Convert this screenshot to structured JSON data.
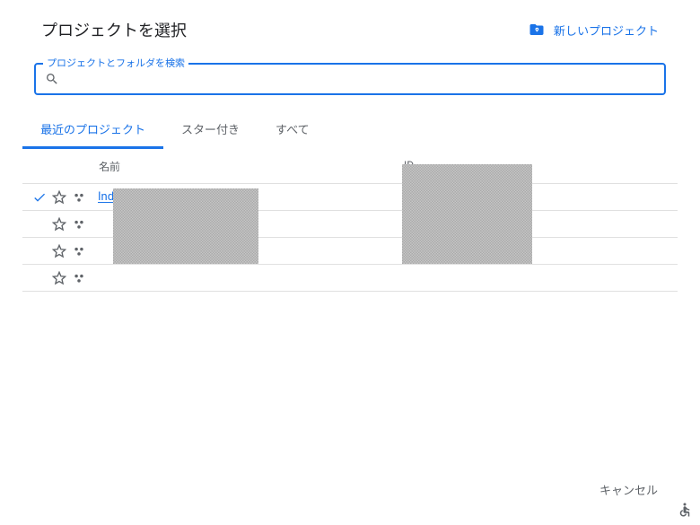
{
  "header": {
    "title": "プロジェクトを選択",
    "new_project_label": "新しいプロジェクト"
  },
  "search": {
    "legend": "プロジェクトとフォルダを検索",
    "value": "",
    "placeholder": ""
  },
  "tabs": {
    "recent": "最近のプロジェクト",
    "starred": "スター付き",
    "all": "すべて"
  },
  "table": {
    "columns": {
      "name": "名前",
      "id": "ID"
    },
    "rows": [
      {
        "selected": true,
        "name": "Indexing",
        "id": ""
      },
      {
        "selected": false,
        "name": "",
        "id": ""
      },
      {
        "selected": false,
        "name": "",
        "id": ""
      },
      {
        "selected": false,
        "name": "",
        "id": ""
      }
    ]
  },
  "footer": {
    "cancel": "キャンセル"
  },
  "icons": {
    "help": "?"
  }
}
